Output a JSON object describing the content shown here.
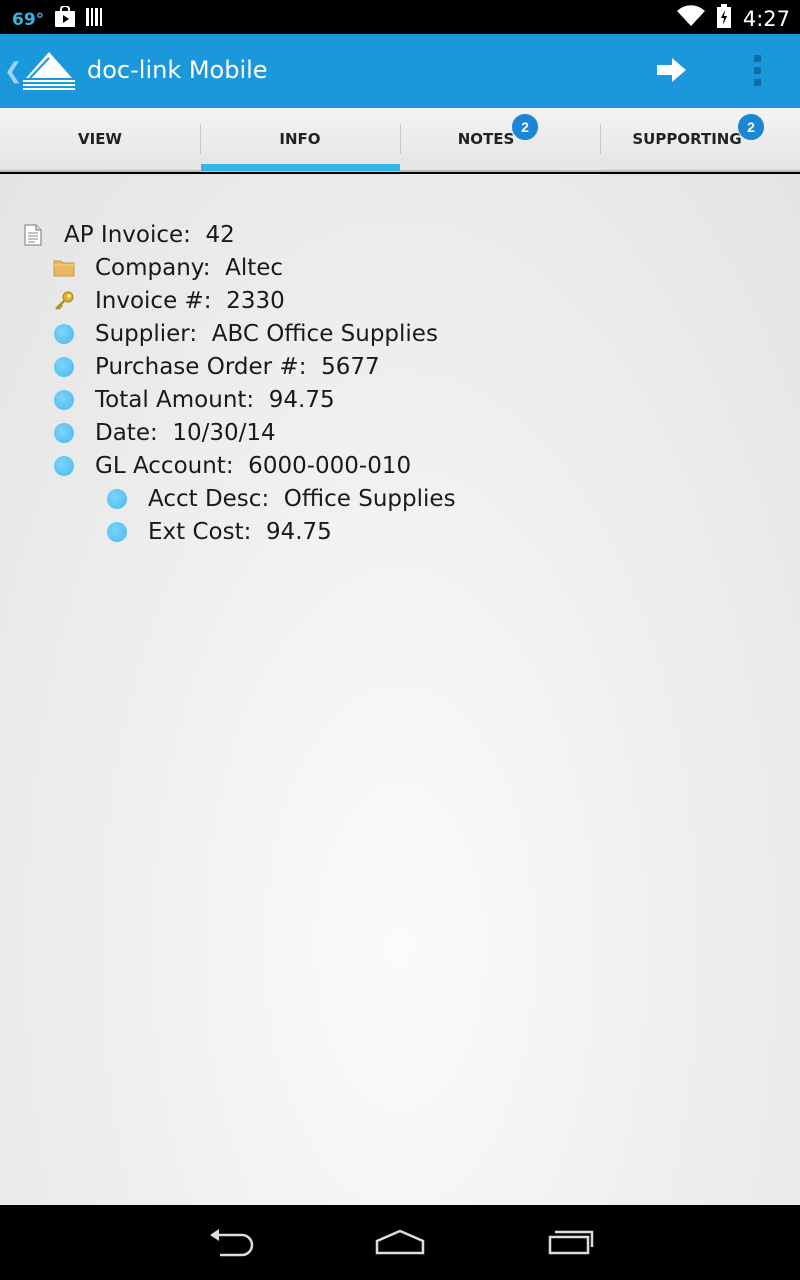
{
  "status_bar": {
    "temperature": "69°",
    "time": "4:27",
    "icons": [
      "play-store-icon",
      "barcode-icon",
      "wifi-icon",
      "battery-icon"
    ]
  },
  "action_bar": {
    "title": "doc-link Mobile",
    "icons": [
      "up-chevron-icon",
      "app-logo-icon",
      "forward-arrow-icon",
      "overflow-menu-icon"
    ],
    "background_color": "#1b98dc"
  },
  "tabs": [
    {
      "label": "VIEW"
    },
    {
      "label": "INFO",
      "selected": true
    },
    {
      "label": "NOTES",
      "badge": "2"
    },
    {
      "label": "SUPPORTING",
      "badge": "2"
    }
  ],
  "tree": [
    {
      "icon": "document-icon",
      "label": "AP Invoice:  42"
    },
    {
      "icon": "folder-icon",
      "label": "Company:  Altec"
    },
    {
      "icon": "key-icon",
      "label": "Invoice #:  2330"
    },
    {
      "icon": "bullet-icon",
      "label": "Supplier:  ABC Office Supplies"
    },
    {
      "icon": "bullet-icon",
      "label": "Purchase Order #:  5677"
    },
    {
      "icon": "bullet-icon",
      "label": "Total Amount:  94.75"
    },
    {
      "icon": "bullet-icon",
      "label": "Date:  10/30/14"
    },
    {
      "icon": "bullet-icon",
      "label": "GL Account:  6000-000-010"
    },
    {
      "icon": "bullet-icon",
      "label": "Acct Desc:  Office Supplies"
    },
    {
      "icon": "bullet-icon",
      "label": "Ext Cost:  94.75"
    }
  ],
  "nav_bar": {
    "icons": [
      "back-icon",
      "home-icon",
      "recent-apps-icon"
    ]
  },
  "colors": {
    "accent": "#33b5e5",
    "badge": "#1b87d4",
    "bullet": "#5ac4f6"
  }
}
